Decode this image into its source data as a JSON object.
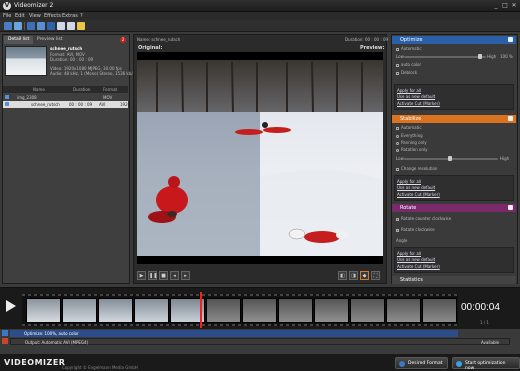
{
  "window": {
    "title": "Videomizer 2",
    "controls": [
      "_",
      "□",
      "✕"
    ]
  },
  "menu": [
    "File",
    "Edit",
    "View",
    "Effects",
    "Extras",
    "?"
  ],
  "left_panel": {
    "tabs": [
      "Detail list",
      "Preview list"
    ],
    "badge": "2",
    "file_info": {
      "name": "schnee_rutsch",
      "format": "Format: AVI, MOV",
      "duration": "Duration: 00 : 00 : 09",
      "video": "Video: 1920x1080 MJPEG, 30.00 fps",
      "audio": "Audio: 48 kHz, 1 (Mono) Stereo, 1536 kb/s"
    },
    "columns": [
      "Name",
      "Duration",
      "Format"
    ],
    "rows": [
      {
        "name": "img_2308",
        "duration": "",
        "format": "MOV"
      },
      {
        "name": "schnee_rutsch",
        "duration": "00 : 00 : 09",
        "format": "AVI",
        "extra": "1920"
      }
    ]
  },
  "center": {
    "name_label": "Name: schnee_rutsch",
    "duration_label": "Duration: 00 : 00 : 09",
    "original": "Original:",
    "preview": "Preview:"
  },
  "right_panel": {
    "optimize": {
      "title": "Optimize",
      "color": "#2b5fa8",
      "automatic": "Automatic",
      "low": "Low",
      "high": "High",
      "level": "100 %",
      "auto_color": "auto color",
      "deblock": "Deblock",
      "apply": "Apply for all",
      "default": "Use as new default",
      "activate": "Activate Cut (Marker)"
    },
    "stabilize": {
      "title": "Stabilize",
      "color": "#d9731f",
      "automatic": "Automatic",
      "everything": "Everything",
      "panning": "Panning only",
      "rotation": "Rotation only",
      "low": "Low",
      "high": "High",
      "change": "Change resolution",
      "apply": "Apply for all",
      "default": "Use as new default",
      "activate": "Activate Cut (Marker)"
    },
    "rotate": {
      "title": "Rotate",
      "color": "#7a2a6a",
      "counter": "Rotate counter clockwise",
      "clockwise": "Rotate clockwise",
      "angle": "Angle",
      "apply": "Apply for all",
      "default": "Use as new default",
      "activate": "Activate Cut (Marker)"
    },
    "statistics": {
      "title": "Statistics"
    }
  },
  "timeline": {
    "timecode": "00:00:04",
    "subcode": "1 / 1",
    "optimization_row": "Optimize: 100%, auto color",
    "output_row": "Output: Automatic AVI (MPEG4)",
    "output_right": "Available"
  },
  "bottom": {
    "brand": "VIDEOMIZER",
    "copyright": "Copyright © Engelmann Media GmbH",
    "desired_format": "Desired Format",
    "start": "Start optimization now"
  },
  "colors": {
    "accent_blue": "#2c4d8a",
    "orange": "#d9731f",
    "purple": "#7a2a6a"
  }
}
